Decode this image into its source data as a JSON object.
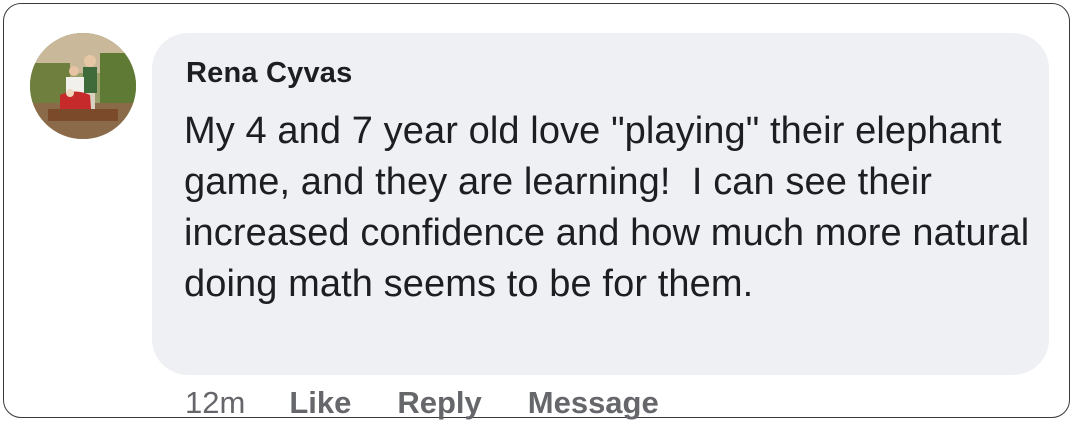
{
  "comment": {
    "author": "Rena Cyvas",
    "avatar_icon": "profile-photo",
    "text": "My 4 and 7 year old love \"playing\" their elephant game, and they are learning!  I can see their increased confidence and how much more natural doing math seems to be for them."
  },
  "actions": {
    "timestamp": "12m",
    "like_label": "Like",
    "reply_label": "Reply",
    "message_label": "Message"
  },
  "colors": {
    "bubble_background": "#eff0f4",
    "text_primary": "#1c1e21",
    "text_secondary": "#65676b"
  }
}
